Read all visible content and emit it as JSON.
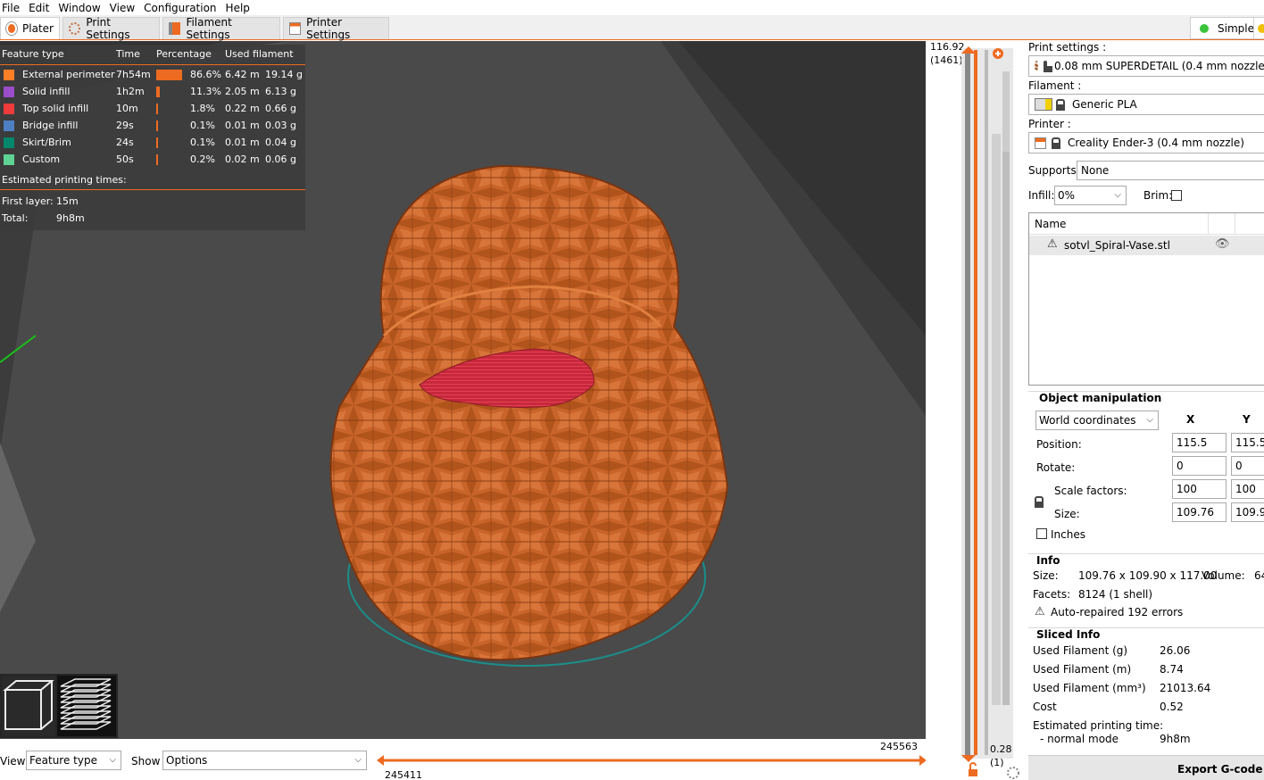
{
  "menu": [
    "File",
    "Edit",
    "Window",
    "View",
    "Configuration",
    "Help"
  ],
  "tabs": {
    "plater": "Plater",
    "print_settings": "Print Settings",
    "filament_settings": "Filament Settings",
    "printer_settings": "Printer Settings",
    "mode_simple": "Simple"
  },
  "legend": {
    "headers": {
      "feature_type": "Feature type",
      "time": "Time",
      "percentage": "Percentage",
      "used_filament": "Used filament"
    },
    "rows": [
      {
        "name": "External perimeter",
        "time": "7h54m",
        "percent": "86.6%",
        "fraction": 0.866,
        "length": "6.42 m",
        "weight": "19.14 g",
        "color": "#ff7f27"
      },
      {
        "name": "Solid infill",
        "time": "1h2m",
        "percent": "11.3%",
        "fraction": 0.113,
        "length": "2.05 m",
        "weight": "6.13 g",
        "color": "#9b4dca"
      },
      {
        "name": "Top solid infill",
        "time": "10m",
        "percent": "1.8%",
        "fraction": 0.018,
        "length": "0.22 m",
        "weight": "0.66 g",
        "color": "#ef3b3b"
      },
      {
        "name": "Bridge infill",
        "time": "29s",
        "percent": "0.1%",
        "fraction": 0.001,
        "length": "0.01 m",
        "weight": "0.03 g",
        "color": "#4d7fc3"
      },
      {
        "name": "Skirt/Brim",
        "time": "24s",
        "percent": "0.1%",
        "fraction": 0.001,
        "length": "0.01 m",
        "weight": "0.04 g",
        "color": "#00876c"
      },
      {
        "name": "Custom",
        "time": "50s",
        "percent": "0.2%",
        "fraction": 0.002,
        "length": "0.02 m",
        "weight": "0.06 g",
        "color": "#5ed394"
      }
    ],
    "estimated_title": "Estimated printing times:",
    "first_layer_label": "First layer:",
    "first_layer_value": "15m",
    "total_label": "Total:",
    "total_value": "9h8m"
  },
  "bottom": {
    "view_label": "View",
    "view_value": "Feature type",
    "show_label": "Show",
    "show_value": "Options",
    "hslider_right": "245563",
    "hslider_left": "245411"
  },
  "vslider": {
    "top_value": "116.92",
    "top_layer": "(1461)",
    "bottom_value": "0.28",
    "bottom_layer": "(1)"
  },
  "sidebar": {
    "print_settings_label": "Print settings :",
    "print_settings_value": "0.08 mm SUPERDETAIL (0.4 mm nozzle)",
    "filament_label": "Filament :",
    "filament_value": "Generic PLA",
    "printer_label": "Printer :",
    "printer_value": "Creality Ender-3 (0.4 mm nozzle)",
    "supports_label": "Supports:",
    "supports_value": "None",
    "infill_label": "Infill:",
    "infill_value": "0%",
    "brim_label": "Brim:",
    "objects_header": "Name",
    "object_name": "sotvl_Spiral-Vase.stl",
    "object_manipulation": "Object manipulation",
    "coords_value": "World coordinates",
    "x_header": "X",
    "y_header": "Y",
    "position_label": "Position:",
    "position_x": "115.5",
    "position_y": "115.5",
    "rotate_label": "Rotate:",
    "rotate_x": "0",
    "rotate_y": "0",
    "scale_label": "Scale factors:",
    "scale_x": "100",
    "scale_y": "100",
    "size_label": "Size:",
    "size_x": "109.76",
    "size_y": "109.9",
    "inches_label": "Inches",
    "info_title": "Info",
    "info_size_label": "Size:",
    "info_size_value": "109.76 x 109.90 x 117.00",
    "info_volume_label": "Volume:",
    "info_volume_value": "64",
    "info_facets_label": "Facets:",
    "info_facets_value": "8124 (1 shell)",
    "info_repaired": "Auto-repaired 192 errors",
    "sliced_title": "Sliced Info",
    "used_g_label": "Used Filament (g)",
    "used_g_value": "26.06",
    "used_m_label": "Used Filament (m)",
    "used_m_value": "8.74",
    "used_mm3_label": "Used Filament (mm³)",
    "used_mm3_value": "21013.64",
    "cost_label": "Cost",
    "cost_value": "0.52",
    "est_time_label": "Estimated printing time:",
    "normal_mode_label": "- normal mode",
    "normal_mode_value": "9h8m",
    "export_button": "Export G-code"
  }
}
